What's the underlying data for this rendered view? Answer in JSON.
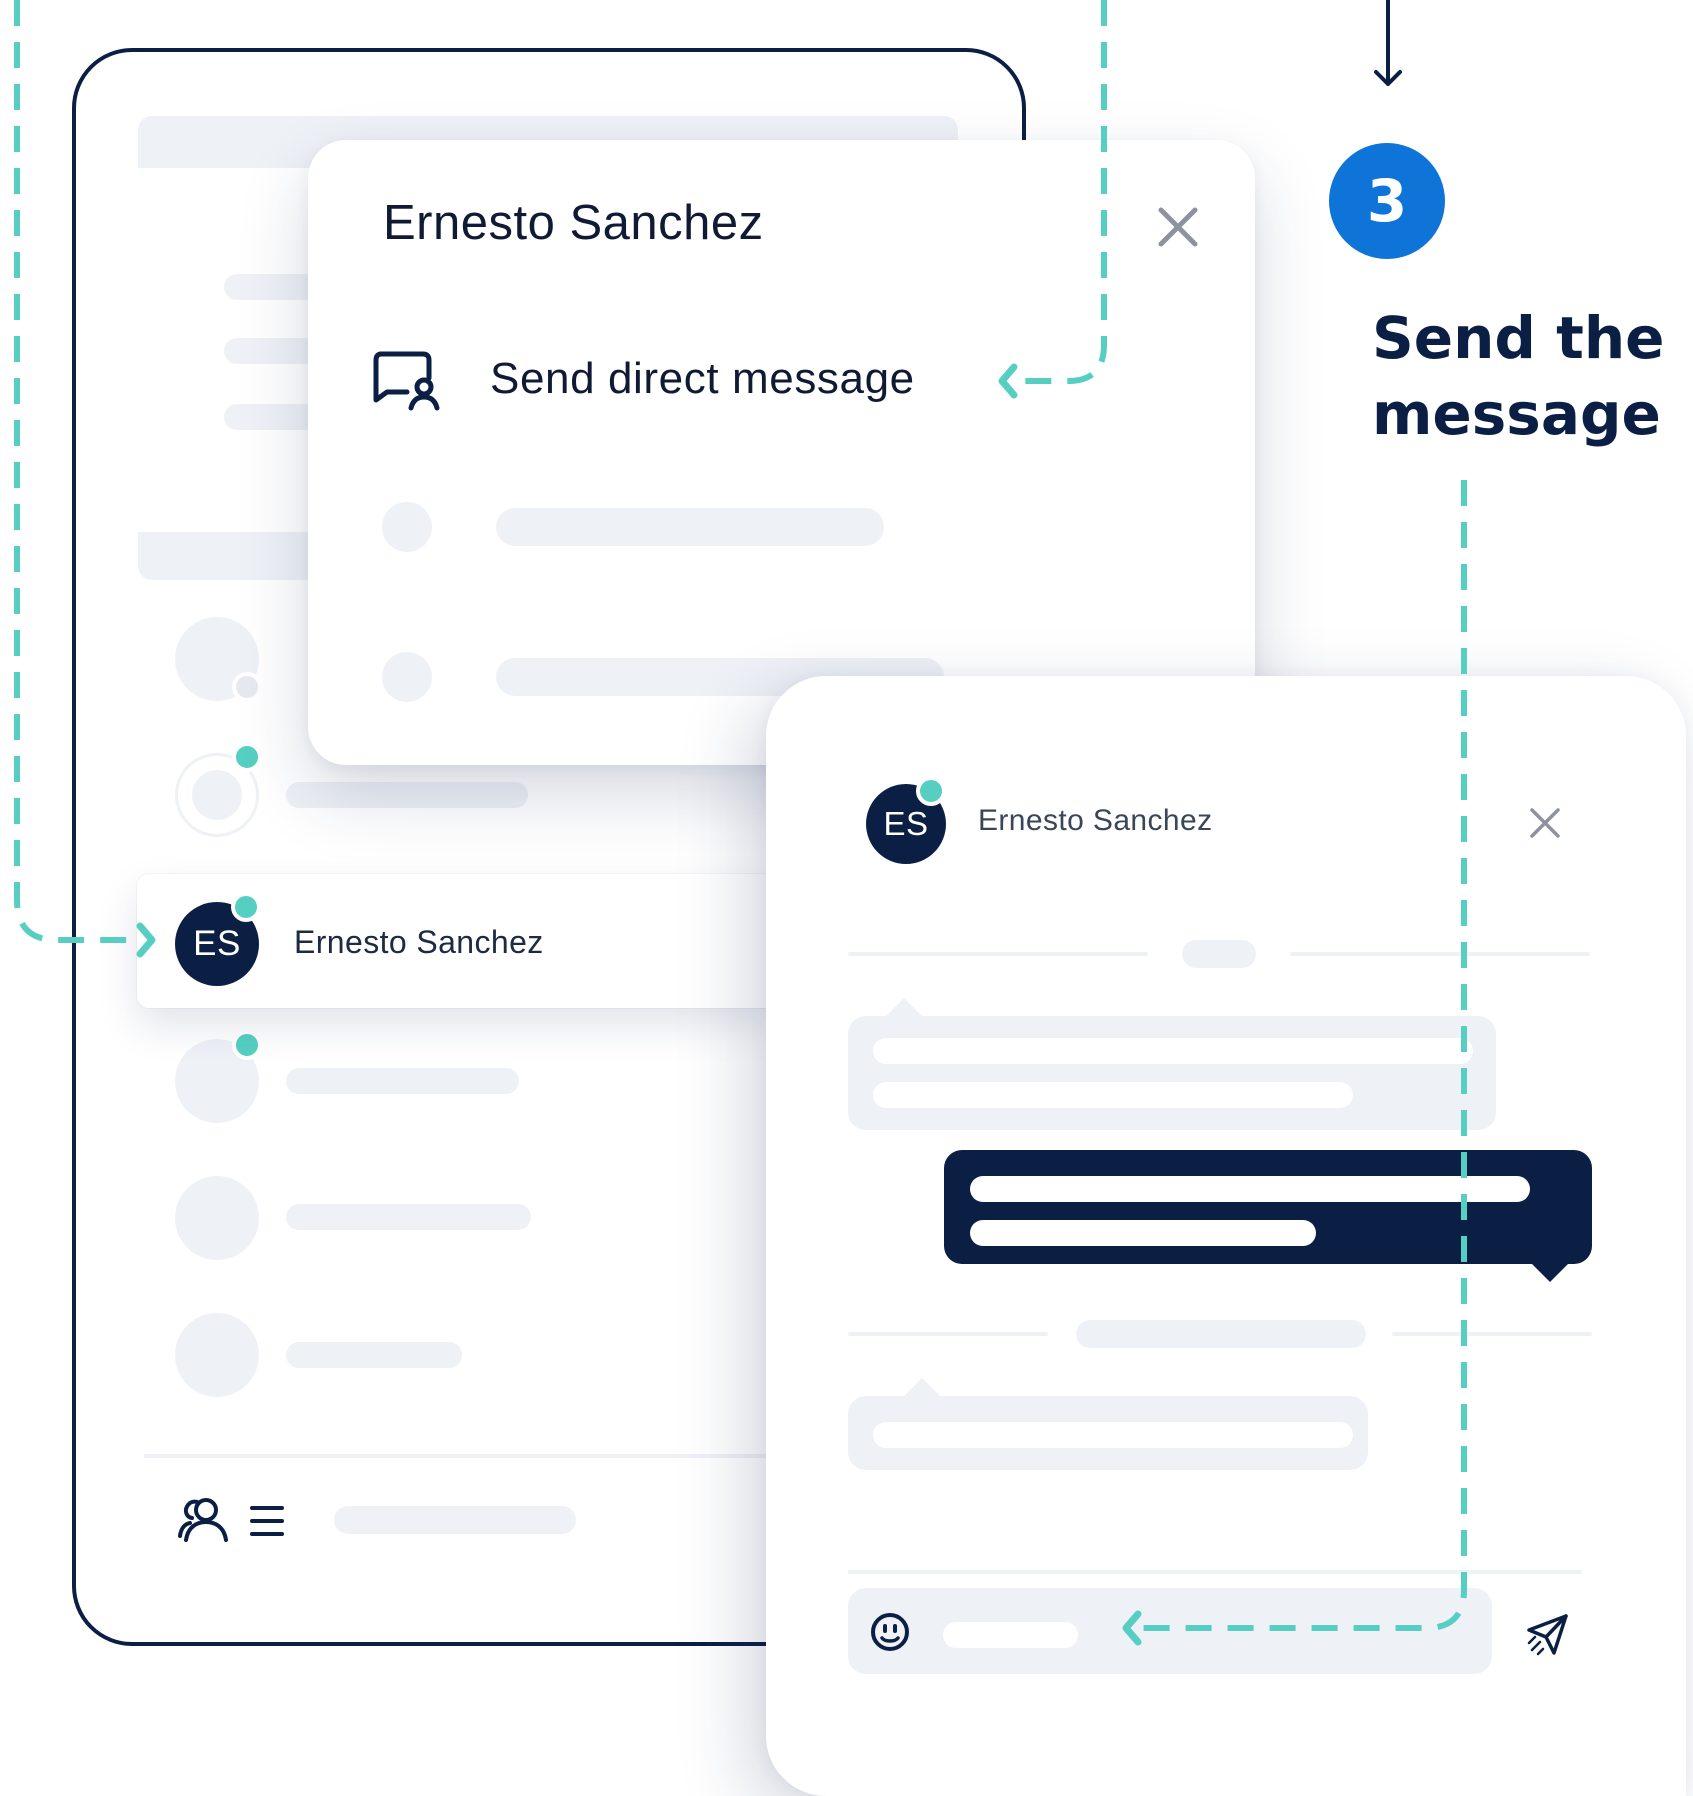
{
  "contact": {
    "name": "Ernesto Sanchez",
    "initials": "ES",
    "status_color": "#56cfc2"
  },
  "popup": {
    "action_label": "Send direct message",
    "action_icon": "chat-user-icon",
    "close_icon": "close-icon"
  },
  "chat": {
    "close_icon": "close-icon",
    "emoji_icon": "smiley-icon",
    "send_icon": "paper-plane-icon"
  },
  "bottom_bar": {
    "icons": [
      "users-icon",
      "menu-icon"
    ]
  },
  "step": {
    "number": "3",
    "heading_line1": "Send the",
    "heading_line2": "message"
  },
  "colors": {
    "navy": "#0b1f45",
    "teal": "#56cfc2",
    "blue": "#0f74d8",
    "skeleton": "#eef1f6"
  }
}
